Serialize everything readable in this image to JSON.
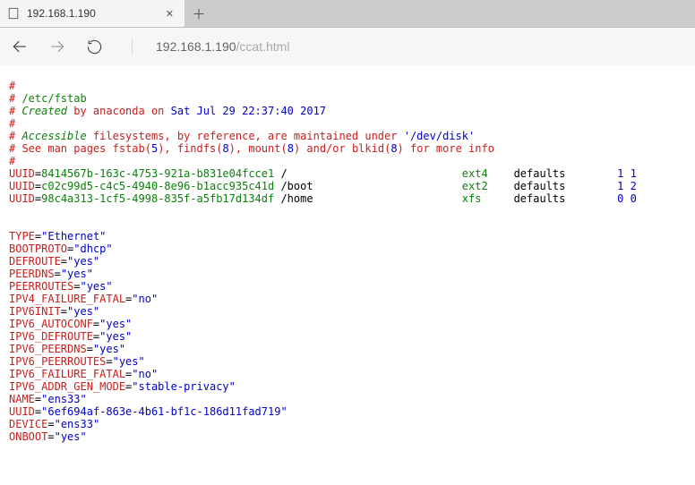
{
  "browser": {
    "tab_title": "192.168.1.190",
    "url_host": "192.168.1.190",
    "url_path": "/ccat.html"
  },
  "fstab": {
    "hash": "#",
    "path_line_prefix": "# ",
    "path": "/etc/fstab",
    "created_prefix": "# ",
    "created_word": "Created",
    "created_mid": " by anaconda on ",
    "created_date": "Sat Jul 29 22:37:40 2017",
    "accessible_prefix": "# ",
    "accessible_word": "Accessible",
    "accessible_mid": " filesystems, by reference, are maintained under ",
    "accessible_path": "'/dev/disk'",
    "see_prefix": "# See man pages fstab(",
    "n5": "5",
    "see_mid1": "), findfs(",
    "n8a": "8",
    "see_mid2": "), mount(",
    "n8b": "8",
    "see_mid3": ") and/or blkid(",
    "n8c": "8",
    "see_end": ") for more info",
    "row1": {
      "key": "UUID",
      "eq": "=",
      "val": "8414567b-163c-4753-921a-b831e04fcce1",
      "mount": " /       ",
      "fs": "ext4",
      "opts": "    defaults        ",
      "d1": "1",
      "sp": " ",
      "d2": "1"
    },
    "row2": {
      "key": "UUID",
      "eq": "=",
      "val": "c02c99d5-c4c5-4940-8e96-b1acc935c41d",
      "mount": " /boot   ",
      "fs": "ext2",
      "opts": "    defaults        ",
      "d1": "1",
      "sp": " ",
      "d2": "2"
    },
    "row3": {
      "key": "UUID",
      "eq": "=",
      "val": "98c4a313-1cf5-4998-835f-a5fb17d134df",
      "mount": " /home   ",
      "fs": "xfs ",
      "opts": "    defaults        ",
      "d1": "0",
      "sp": " ",
      "d2": "0"
    }
  },
  "ifcfg": {
    "line01": {
      "k": "TYPE",
      "eq": "=",
      "v": "\"Ethernet\""
    },
    "line02": {
      "k": "BOOTPROTO",
      "eq": "=",
      "v": "\"dhcp\""
    },
    "line03": {
      "k": "DEFROUTE",
      "eq": "=",
      "v": "\"yes\""
    },
    "line04": {
      "k": "PEERDNS",
      "eq": "=",
      "v": "\"yes\""
    },
    "line05": {
      "k": "PEERROUTES",
      "eq": "=",
      "v": "\"yes\""
    },
    "line06": {
      "k": "IPV4_FAILURE_FATAL",
      "eq": "=",
      "v": "\"no\""
    },
    "line07": {
      "k": "IPV6INIT",
      "eq": "=",
      "v": "\"yes\""
    },
    "line08": {
      "k": "IPV6_AUTOCONF",
      "eq": "=",
      "v": "\"yes\""
    },
    "line09": {
      "k": "IPV6_DEFROUTE",
      "eq": "=",
      "v": "\"yes\""
    },
    "line10": {
      "k": "IPV6_PEERDNS",
      "eq": "=",
      "v": "\"yes\""
    },
    "line11": {
      "k": "IPV6_PEERROUTES",
      "eq": "=",
      "v": "\"yes\""
    },
    "line12": {
      "k": "IPV6_FAILURE_FATAL",
      "eq": "=",
      "v": "\"no\""
    },
    "line13": {
      "k": "IPV6_ADDR_GEN_MODE",
      "eq": "=",
      "v": "\"stable-privacy\""
    },
    "line14": {
      "k": "NAME",
      "eq": "=",
      "v": "\"ens33\""
    },
    "line15": {
      "k": "UUID",
      "eq": "=",
      "v": "\"6ef694af-863e-4b61-bf1c-186d11fad719\""
    },
    "line16": {
      "k": "DEVICE",
      "eq": "=",
      "v": "\"ens33\""
    },
    "line17": {
      "k": "ONBOOT",
      "eq": "=",
      "v": "\"yes\""
    }
  },
  "pad": {
    "mount_to_fs": "                    "
  }
}
